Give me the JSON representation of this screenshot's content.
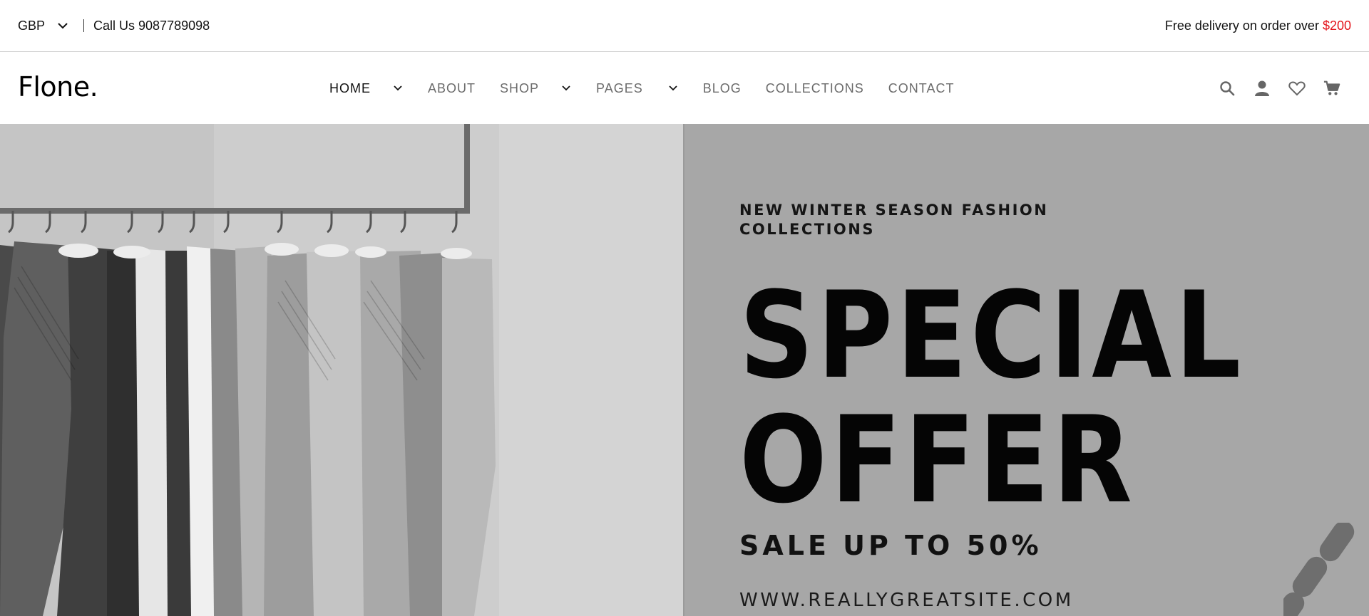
{
  "topbar": {
    "currency": "GBP",
    "call_us": "Call Us 9087789098",
    "delivery_text": "Free delivery on order over ",
    "delivery_amount": "$200",
    "accent_color": "#e3131b"
  },
  "header": {
    "logo": "Flone.",
    "nav": [
      {
        "label": "HOME",
        "active": true,
        "has_dropdown": true
      },
      {
        "label": "ABOUT",
        "active": false,
        "has_dropdown": false
      },
      {
        "label": "SHOP",
        "active": false,
        "has_dropdown": true
      },
      {
        "label": "PAGES",
        "active": false,
        "has_dropdown": true
      },
      {
        "label": "BLOG",
        "active": false,
        "has_dropdown": false
      },
      {
        "label": "COLLECTIONS",
        "active": false,
        "has_dropdown": false
      },
      {
        "label": "CONTACT",
        "active": false,
        "has_dropdown": false
      }
    ],
    "icons": [
      "search-icon",
      "user-icon",
      "heart-icon",
      "cart-icon"
    ]
  },
  "hero": {
    "eyebrow": "NEW WINTER SEASON FASHION COLLECTIONS",
    "headline_line1": "SPECIAL",
    "headline_line2": "OFFER",
    "sale": "SALE UP TO 50%",
    "website": "WWW.REALLYGREATSITE.COM",
    "image": "clothes-rack-photo"
  }
}
